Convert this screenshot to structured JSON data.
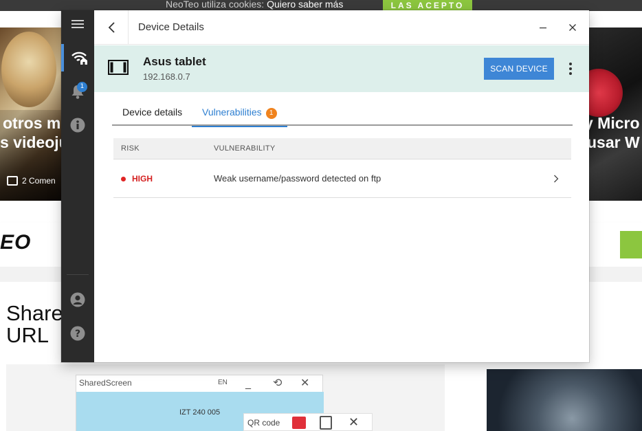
{
  "background": {
    "cookie_text": "NeoTeo utiliza cookies:",
    "cookie_link": "Quiero saber más",
    "cookie_accept": "LAS ACEPTO",
    "left_headline_1": "otros m",
    "left_headline_2": "s videoju",
    "left_comments": "2 Comen",
    "right_headline_1": "y Micro",
    "right_headline_2": "usar W",
    "site_logo": "EO",
    "share_title_1": "Share",
    "share_title_2": "URL",
    "shared_screen_title": "SharedScreen",
    "shared_screen_lang": "EN",
    "shared_screen_text": "IZT 240 005",
    "qr_label": "QR code"
  },
  "sidebar": {
    "items": [
      {
        "icon": "menu-icon"
      },
      {
        "icon": "wifi-home-icon",
        "active": true
      },
      {
        "icon": "bell-icon",
        "badge": "1"
      },
      {
        "icon": "info-icon"
      },
      {
        "icon": "user-icon"
      },
      {
        "icon": "help-icon"
      }
    ]
  },
  "titlebar": {
    "title": "Device Details"
  },
  "device": {
    "name": "Asus tablet",
    "ip": "192.168.0.7",
    "scan_label": "SCAN DEVICE"
  },
  "tabs": {
    "details": "Device details",
    "vulnerabilities": "Vulnerabilities",
    "vulnerabilities_count": "1"
  },
  "table": {
    "headers": [
      "RISK",
      "VULNERABILITY"
    ],
    "rows": [
      {
        "risk": "HIGH",
        "vulnerability": "Weak username/password detected on ftp"
      }
    ]
  },
  "colors": {
    "accent": "#3e86d6",
    "risk_high": "#d42020",
    "badge_orange": "#f0831e",
    "header_bg": "#ddefeb"
  }
}
